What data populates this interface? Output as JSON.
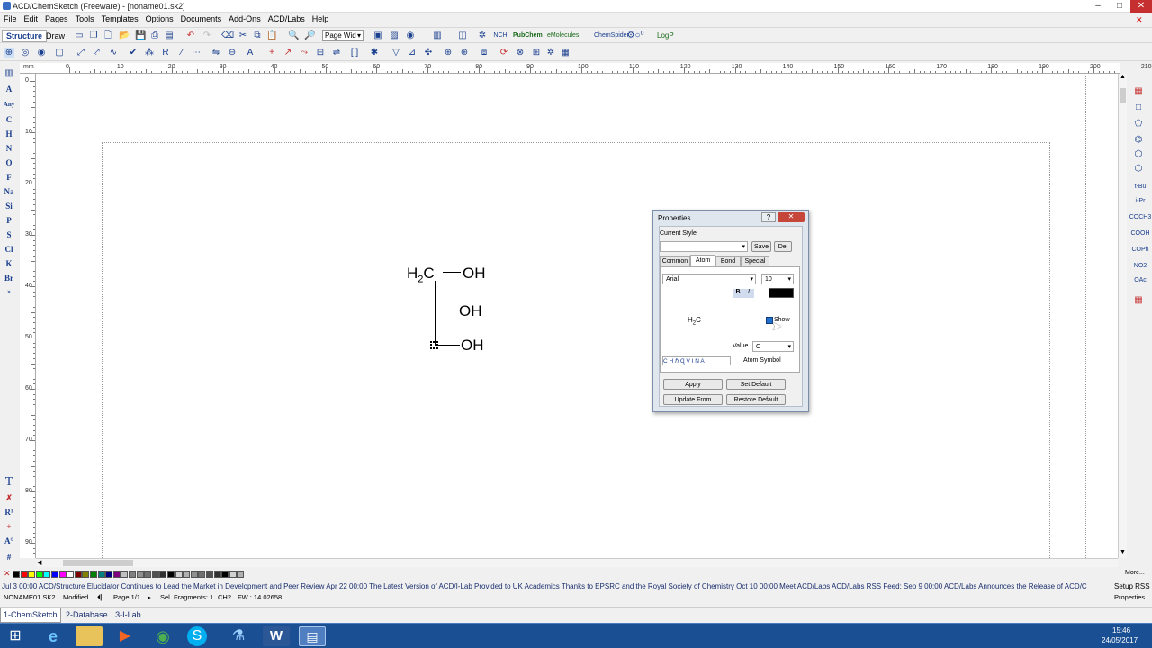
{
  "window": {
    "title": "ACD/ChemSketch (Freeware) - [noname01.sk2]",
    "controls": [
      "–",
      "□",
      "✕"
    ]
  },
  "menu": [
    "File",
    "Edit",
    "Pages",
    "Tools",
    "Templates",
    "Options",
    "Documents",
    "Add-Ons",
    "ACD/Labs",
    "Help"
  ],
  "toolbar": {
    "mode_structure": "Structure",
    "mode_draw": "Draw",
    "zoom_select": "Page Wid",
    "pubchem": "PubChem",
    "emolecules": "eMolecules",
    "chemspider": "ChemSpider",
    "logp": "LogP"
  },
  "left_elements": [
    "A",
    "Any",
    "C",
    "H",
    "N",
    "O",
    "F",
    "Na",
    "Si",
    "P",
    "S",
    "Cl",
    "K",
    "Br"
  ],
  "right_groups": [
    "t-Bu",
    "i-Pr",
    "COCH3",
    "COOH",
    "COPh",
    "NO2",
    "OAc"
  ],
  "ruler": {
    "unit": "mm",
    "h_labels": [
      "0",
      "10",
      "20",
      "30",
      "40",
      "50",
      "60",
      "70",
      "80",
      "90",
      "100",
      "110",
      "120",
      "130",
      "140",
      "150",
      "160",
      "170",
      "180",
      "190",
      "200",
      "210"
    ],
    "v_labels": [
      "0",
      "10",
      "20",
      "30",
      "40",
      "50",
      "60",
      "70",
      "80",
      "90"
    ]
  },
  "molecule": {
    "h2c": "H2C",
    "oh1": "OH",
    "oh2": "OH",
    "oh3": "OH"
  },
  "dialog": {
    "title": "Properties",
    "help": "?",
    "current_style_label": "Current Style",
    "save": "Save",
    "del": "Del",
    "tabs": [
      "Common",
      "Atom",
      "Bond",
      "Special"
    ],
    "font": "Arial",
    "size": "10",
    "bold": "B",
    "italic": "I",
    "preview": "H2C",
    "show_label": "Show",
    "value_label": "Value",
    "value": "C",
    "atom_symbol": "Atom Symbol",
    "apply": "Apply",
    "set_default": "Set Default",
    "update_from": "Update From",
    "restore_default": "Restore Default"
  },
  "palette_colors": [
    "#000000",
    "#ff0000",
    "#ffff00",
    "#00ff00",
    "#00ffff",
    "#0000ff",
    "#ff00ff",
    "#ffffff",
    "#800000",
    "#808000",
    "#008000",
    "#008080",
    "#000080",
    "#800080",
    "#c0c0c0",
    "#808080"
  ],
  "palette_more": "More...",
  "ticker": "Jul 3 00:00 ACD/Structure Elucidator Continues to Lead the Market in Development and Peer Review Apr 22 00:00 The Latest Version of ACD/I-Lab Provided to UK Academics Thanks to EPSRC and the Royal Society of Chemistry Oct 10 00:00 Meet ACD/Labs ACD/Labs RSS Feed: Sep 9 00:00 ACD/Labs Announces the Release of ACD/C",
  "ticker_setup": "Setup RSS",
  "status": {
    "file": "NONAME01.SK2",
    "modified": "Modified",
    "page": "Page 1/1",
    "fragments": "Sel. Fragments: 1",
    "formula": "CH2",
    "fw": "FW : 14.02658",
    "properties": "Properties"
  },
  "app_tabs": [
    "1-ChemSketch",
    "2-Database",
    "3-I-Lab"
  ],
  "clock": {
    "time": "15:46",
    "date": "24/05/2017"
  }
}
